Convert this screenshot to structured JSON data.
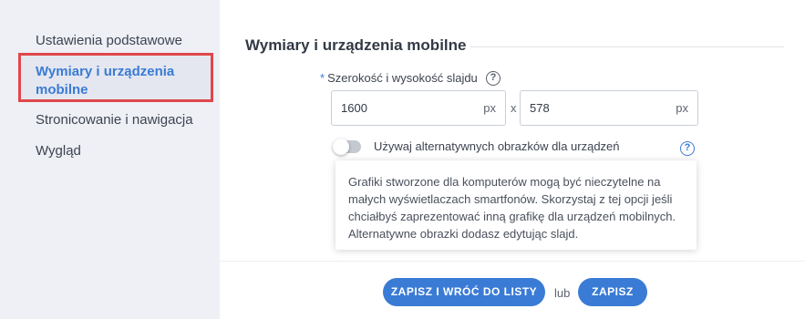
{
  "sidebar": {
    "items": [
      {
        "label": "Ustawienia podstawowe"
      },
      {
        "label": "Wymiary i urządzenia mobilne"
      },
      {
        "label": "Stronicowanie i nawigacja"
      },
      {
        "label": "Wygląd"
      }
    ],
    "active_border_color": "#e0474c",
    "active_text_color": "#3a7bd5"
  },
  "main": {
    "section_title": "Wymiary i urządzenia mobilne",
    "size_field": {
      "required_mark": "*",
      "label": "Szerokość i wysokość slajdu",
      "help_icon": "question-circle-icon",
      "help_glyph": "?",
      "width_value": "1600",
      "width_unit": "px",
      "separator": "x",
      "height_value": "578",
      "height_unit": "px"
    },
    "mobile_toggle": {
      "label": "Używaj alternatywnych obrazków dla urządzeń",
      "state": "off",
      "help_icon": "question-circle-icon",
      "help_glyph": "?"
    },
    "tooltip": {
      "text": "Grafiki stworzone dla komputerów mogą być nieczytelne na małych wyświetlaczach smartfonów. Skorzystaj z tej opcji jeśli chciałbyś zaprezentować inną grafikę dla urządzeń mobilnych. Alternatywne obrazki dodasz edytując slajd."
    }
  },
  "footer": {
    "save_and_back_label": "ZAPISZ I WRÓĆ DO LISTY",
    "or_label": "lub",
    "save_label": "ZAPISZ",
    "button_color": "#3a7bd5"
  }
}
